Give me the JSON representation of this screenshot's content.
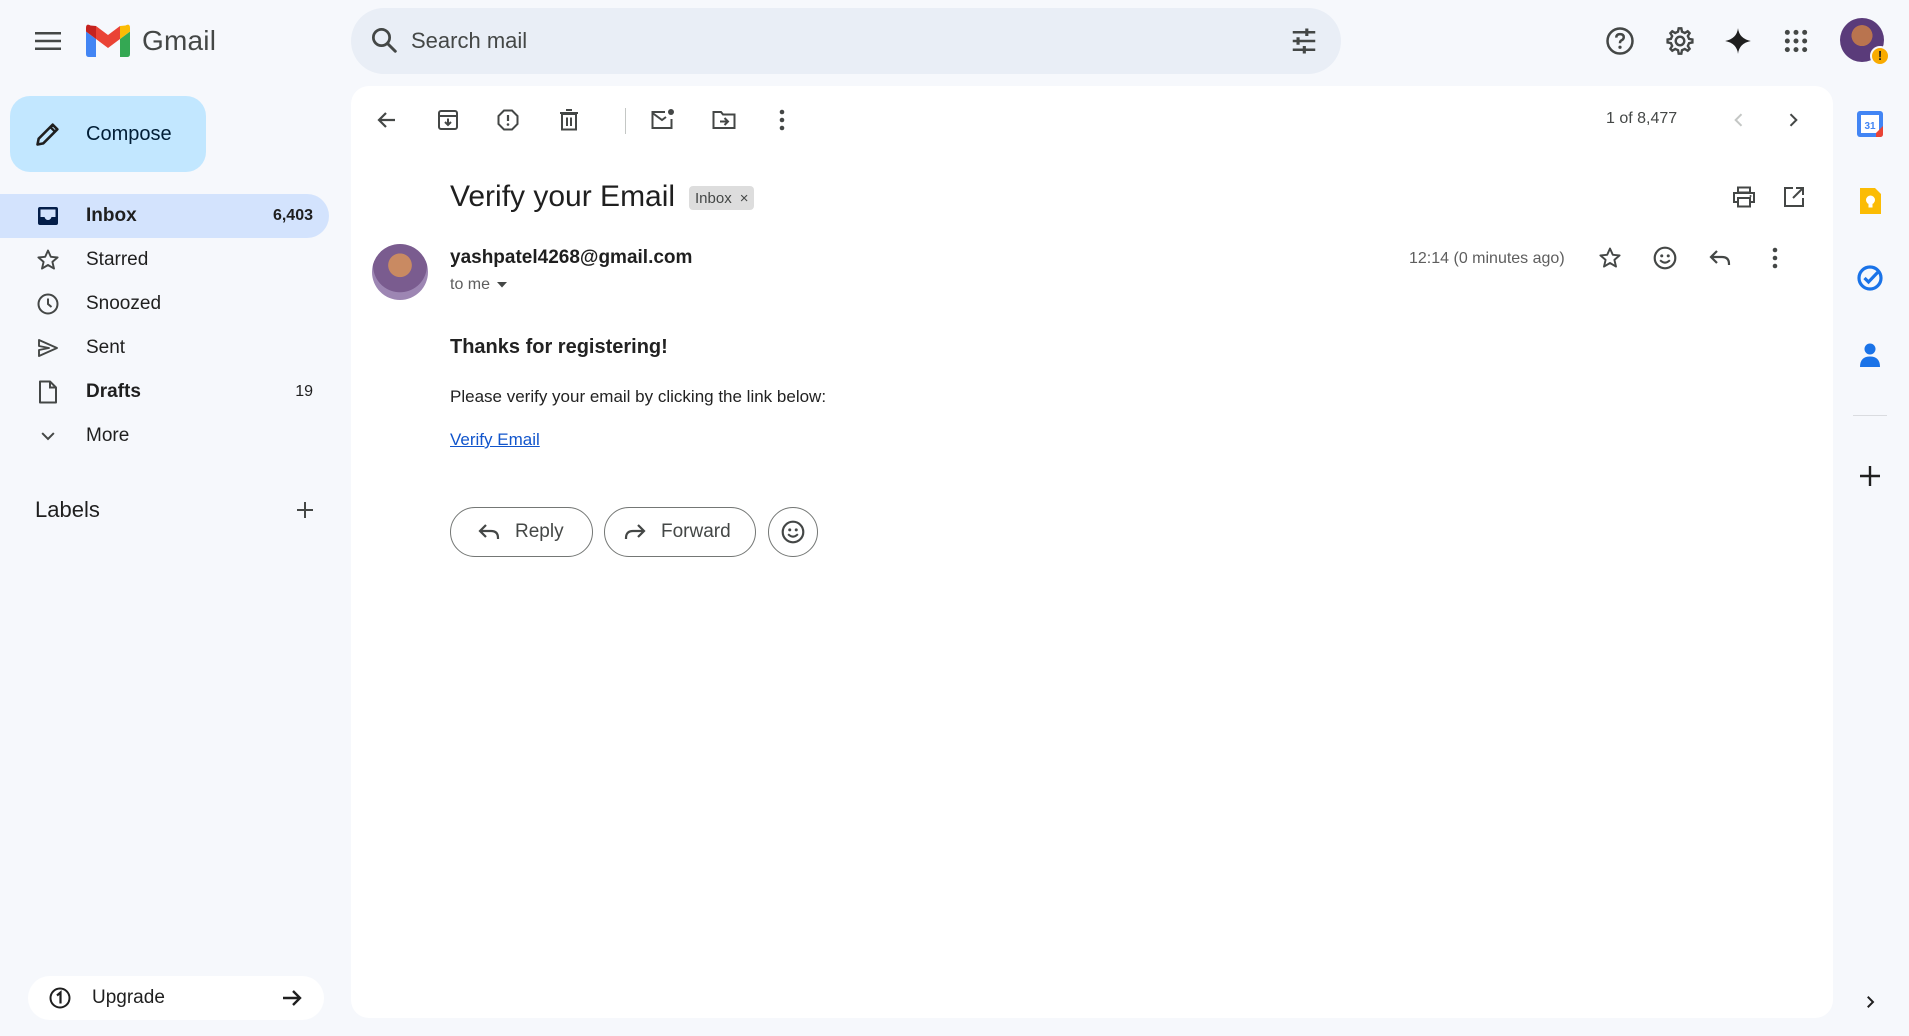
{
  "app": {
    "name": "Gmail"
  },
  "search": {
    "placeholder": "Search mail"
  },
  "compose": {
    "label": "Compose"
  },
  "nav": [
    {
      "label": "Inbox",
      "count": "6,403",
      "icon": "inbox-icon"
    },
    {
      "label": "Starred",
      "count": "",
      "icon": "star-icon"
    },
    {
      "label": "Snoozed",
      "count": "",
      "icon": "clock-icon"
    },
    {
      "label": "Sent",
      "count": "",
      "icon": "send-icon"
    },
    {
      "label": "Drafts",
      "count": "19",
      "icon": "draft-icon"
    },
    {
      "label": "More",
      "count": "",
      "icon": "chevron-down-icon"
    }
  ],
  "labels": {
    "heading": "Labels"
  },
  "upgrade": {
    "label": "Upgrade"
  },
  "toolbar": {
    "pager": "1 of 8,477"
  },
  "email": {
    "subject": "Verify your Email",
    "chip": "Inbox",
    "chip_close": "×",
    "sender": "yashpatel4268@gmail.com",
    "recipient": "to me",
    "time": "12:14 (0 minutes ago)",
    "heading": "Thanks for registering!",
    "paragraph": "Please verify your email by clicking the link below:",
    "link": "Verify Email"
  },
  "actions": {
    "reply": "Reply",
    "forward": "Forward"
  },
  "rail": {
    "calendar_day": "31"
  },
  "colors": {
    "background": "#f6f8fc",
    "compose": "#c2e7ff",
    "active_nav": "#d3e3fd",
    "search": "#e9eef6",
    "link": "#1155cc"
  }
}
